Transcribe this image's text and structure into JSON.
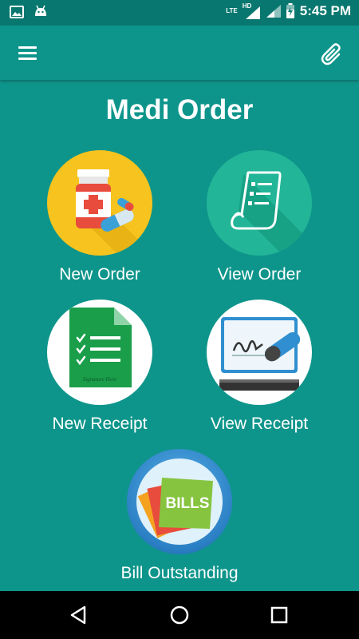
{
  "status_bar": {
    "time": "5:45 PM",
    "network_label": "LTE",
    "hd_label": "HD",
    "icons": [
      "image-icon",
      "android-icon",
      "signal-icon",
      "battery-icon"
    ]
  },
  "app_bar": {
    "menu_icon": "hamburger-menu-icon",
    "attach_icon": "paperclip-icon"
  },
  "title": "Medi Order",
  "tiles": [
    {
      "label": "New Order",
      "icon": "medicine-bottle-icon",
      "color": "#f7c31e"
    },
    {
      "label": "View Order",
      "icon": "prescription-scroll-icon",
      "color": "#22b597"
    },
    {
      "label": "New Receipt",
      "icon": "checklist-document-icon",
      "color": "#ffffff",
      "doc_footer": "Signature Here"
    },
    {
      "label": "View Receipt",
      "icon": "signed-receipt-icon",
      "color": "#ffffff"
    },
    {
      "label": "Bill Outstanding",
      "icon": "bills-icon",
      "color": "#2b7fc4",
      "badge_text": "BILLS"
    }
  ],
  "nav_bar": {
    "buttons": [
      "back-icon",
      "home-icon",
      "recents-icon"
    ]
  },
  "colors": {
    "background": "#0e958b",
    "status_bar": "#08776f",
    "nav_bar": "#000000"
  }
}
